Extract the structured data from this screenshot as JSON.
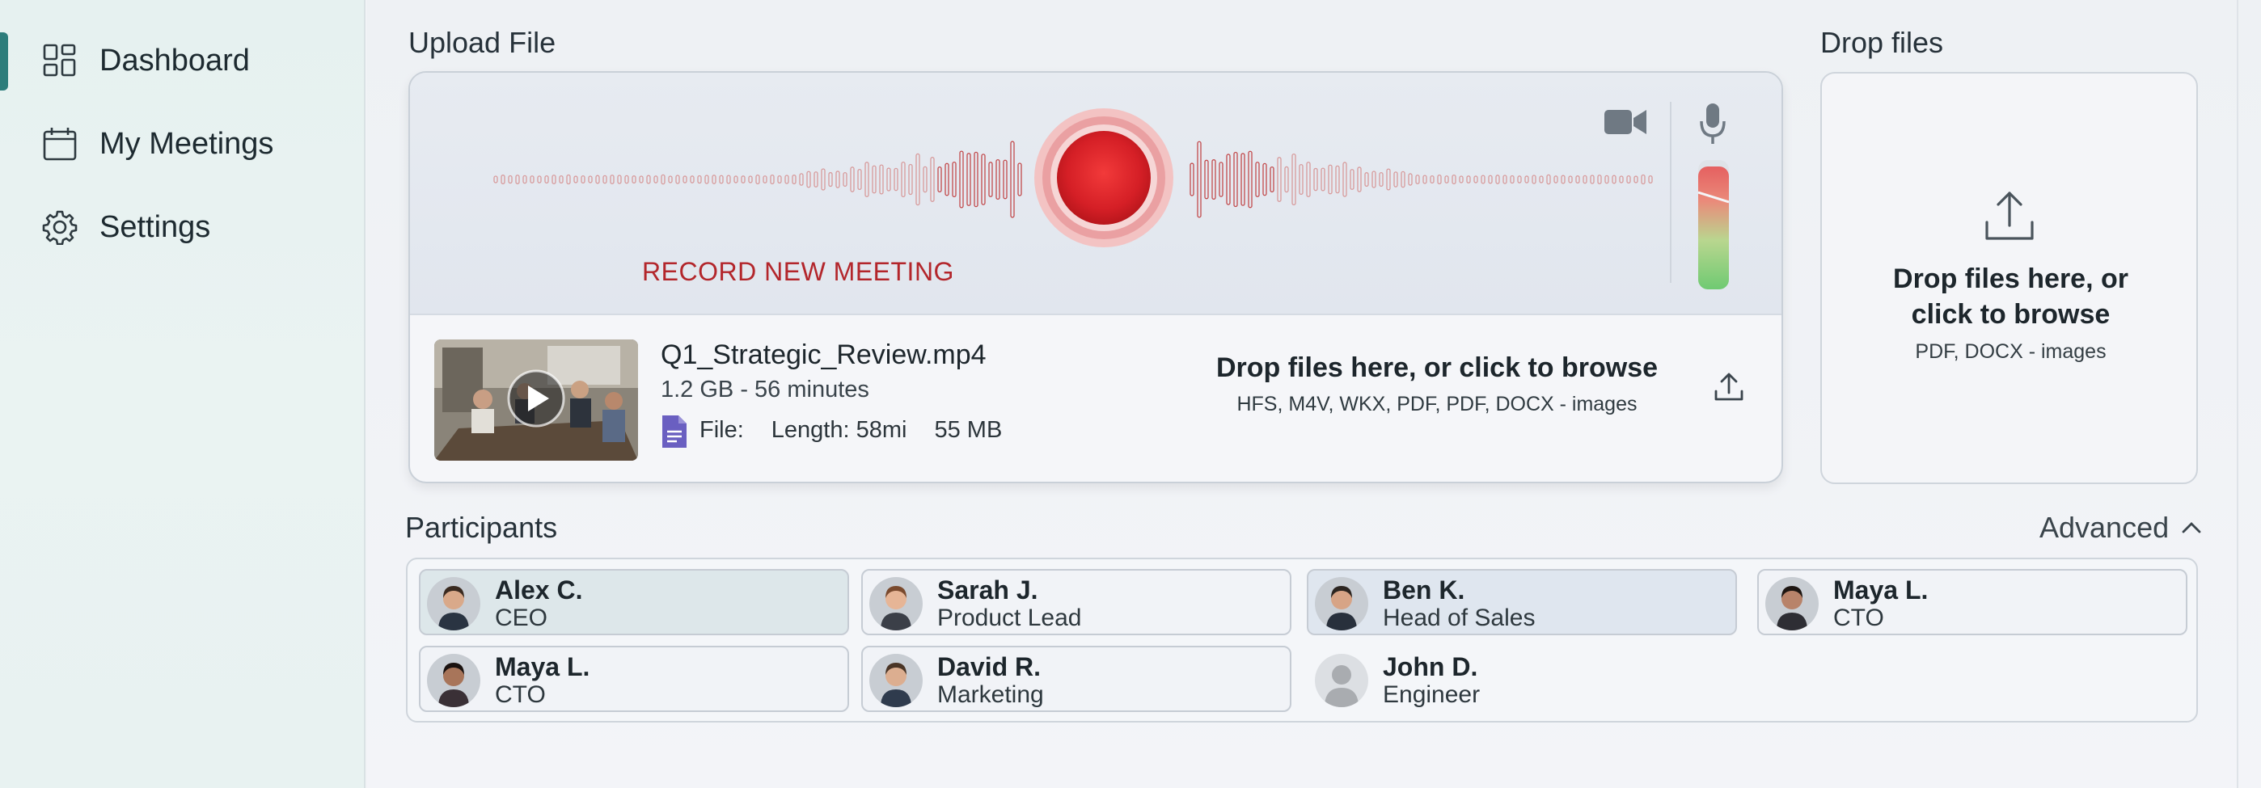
{
  "sidebar": {
    "items": [
      {
        "label": "Dashboard",
        "icon": "dashboard-grid-icon",
        "active": true
      },
      {
        "label": "My Meetings",
        "icon": "calendar-icon",
        "active": false
      },
      {
        "label": "Settings",
        "icon": "gear-icon",
        "active": false
      }
    ]
  },
  "upload": {
    "title": "Upload File",
    "record_label": "RECORD NEW MEETING",
    "camera_icon": "video-camera-icon",
    "mic_icon": "microphone-icon",
    "mic_level": 0.95,
    "file": {
      "name": "Q1_Strategic_Review.mp4",
      "meta": "1.2 GB - 56 minutes",
      "info_label": "File:",
      "length": "Length: 58mi",
      "size": "55 MB"
    },
    "drop_main": "Drop files here, or click to browse",
    "drop_sub": "HFS, M4V, WKX, PDF, PDF, DOCX - images"
  },
  "drop": {
    "title": "Drop files",
    "line1": "Drop files here, or",
    "line2": "click to browse",
    "formats": "PDF, DOCX - images"
  },
  "participants": {
    "title": "Participants",
    "advanced_label": "Advanced",
    "people": [
      {
        "name": "Alex C.",
        "role": "CEO",
        "skin": "#d9a98a",
        "hair": "#3a2a20",
        "suit": "#2a3442"
      },
      {
        "name": "Sarah J.",
        "role": "Product Lead",
        "skin": "#e6b596",
        "hair": "#7a4a2e",
        "suit": "#3b3f48"
      },
      {
        "name": "Ben K.",
        "role": "Head of Sales",
        "skin": "#d7a486",
        "hair": "#2c2520",
        "suit": "#28303c"
      },
      {
        "name": "Maya L.",
        "role": "CTO",
        "skin": "#b8836a",
        "hair": "#1e1612",
        "suit": "#2e2e34"
      },
      {
        "name": "Maya L.",
        "role": "CTO",
        "skin": "#a8755a",
        "hair": "#1a1210",
        "suit": "#3a3036"
      },
      {
        "name": "David R.",
        "role": "Marketing",
        "skin": "#dcae90",
        "hair": "#4a3526",
        "suit": "#2f3b4d"
      },
      {
        "name": "John D.",
        "role": "Engineer",
        "skin": "#a9acb0",
        "hair": "#a9acb0",
        "suit": "#a9acb0"
      }
    ]
  },
  "colors": {
    "accent": "#2d7d7b",
    "record_red": "#d7262c",
    "level_green": "#7fce7e",
    "level_red": "#e06464",
    "file_icon_purple": "#6a5fc1"
  }
}
